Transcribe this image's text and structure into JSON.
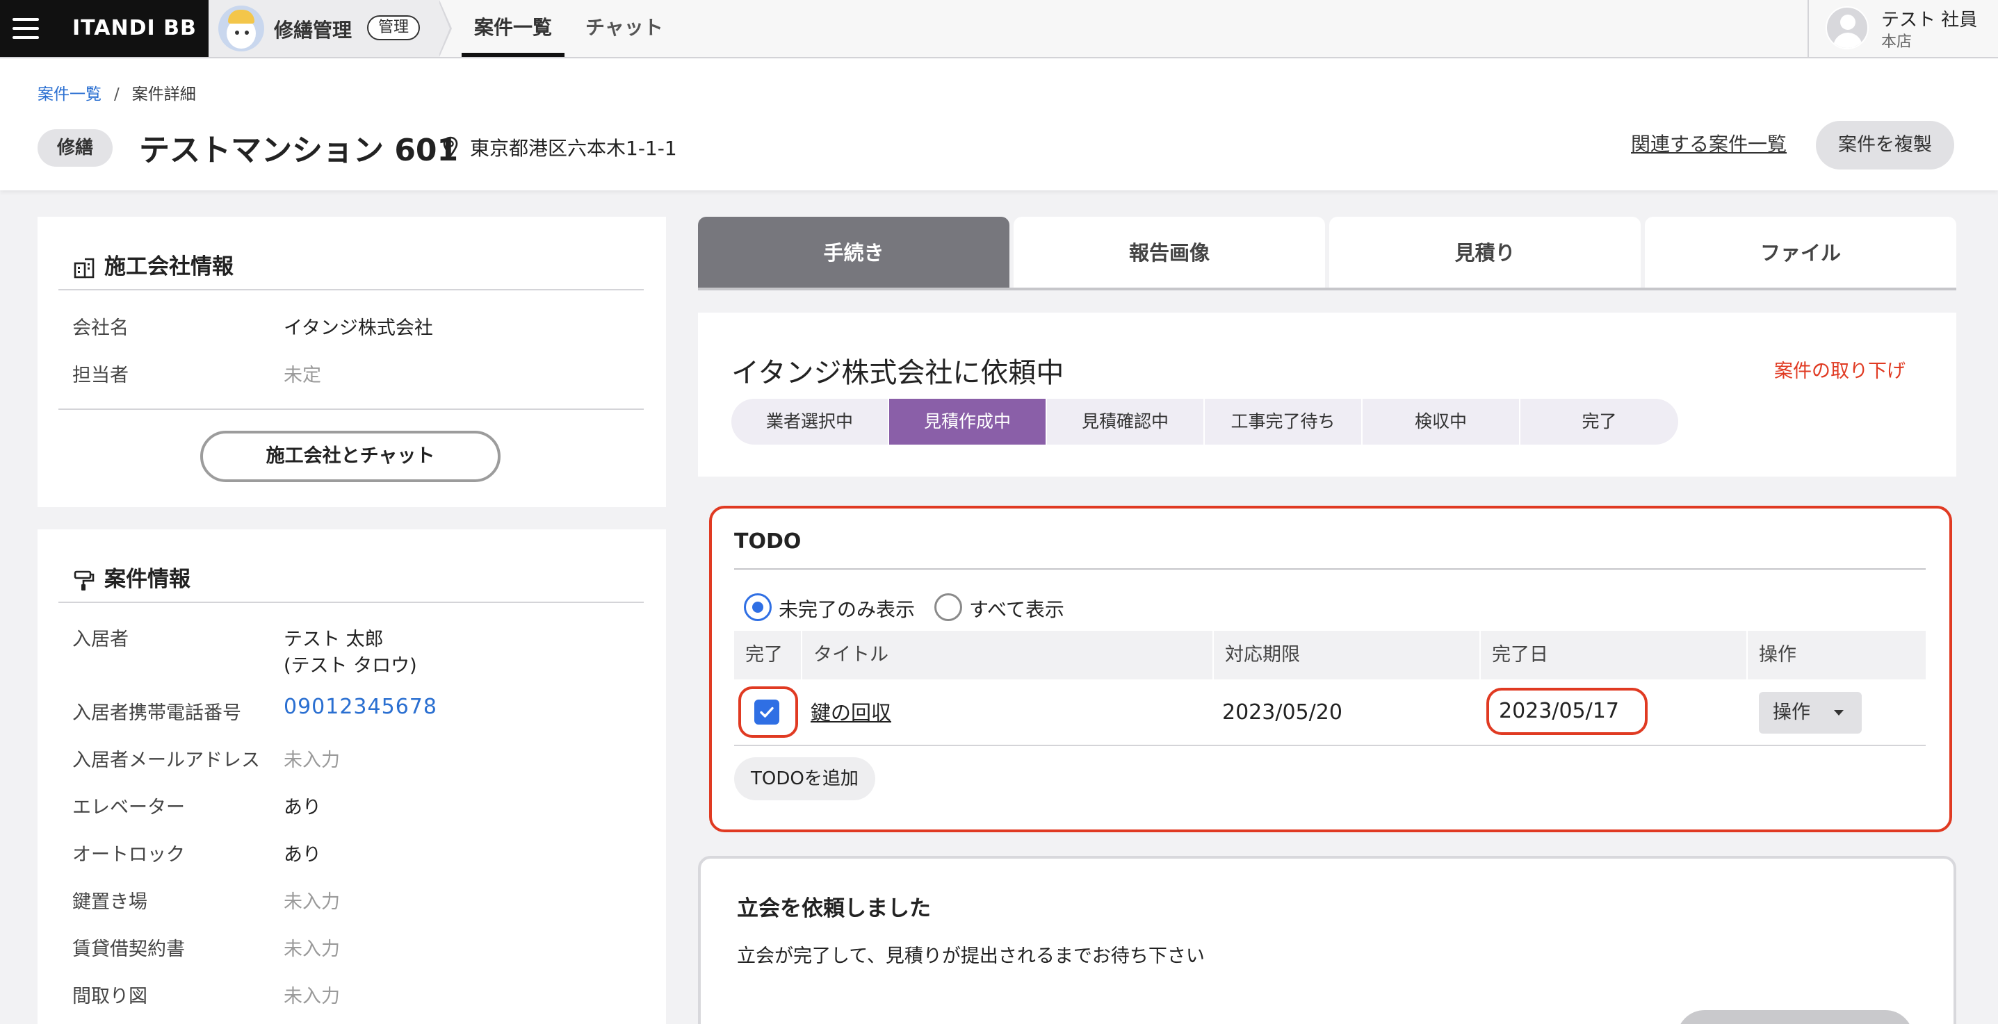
{
  "topbar": {
    "logo": "ITANDI BB",
    "app_name": "修繕管理",
    "app_badge": "管理",
    "nav": [
      "案件一覧",
      "チャット"
    ],
    "user_name": "テスト 社員",
    "user_branch": "本店"
  },
  "header": {
    "breadcrumb": [
      "案件一覧",
      "案件詳細"
    ],
    "breadcrumb_sep": "/",
    "category": "修繕",
    "title": "テストマンション 601",
    "address": "東京都港区六本木1-1-1",
    "related_link": "関連する案件一覧",
    "duplicate_button": "案件を複製"
  },
  "contractor": {
    "title": "施工会社情報",
    "rows": [
      {
        "label": "会社名",
        "value": "イタンジ株式会社"
      },
      {
        "label": "担当者",
        "value": "未定"
      }
    ],
    "chat_button": "施工会社とチャット"
  },
  "case_info": {
    "title": "案件情報",
    "tenant_label": "入居者",
    "tenant_name": "テスト 太郎",
    "tenant_kana": "(テスト タロウ)",
    "rows": [
      {
        "label": "入居者携帯電話番号",
        "value": "09012345678"
      },
      {
        "label": "入居者メールアドレス",
        "value": "未入力"
      },
      {
        "label": "エレベーター",
        "value": "あり"
      },
      {
        "label": "オートロック",
        "value": "あり"
      },
      {
        "label": "鍵置き場",
        "value": "未入力"
      },
      {
        "label": "賃貸借契約書",
        "value": "未入力"
      },
      {
        "label": "間取り図",
        "value": "未入力"
      }
    ]
  },
  "tabs": [
    "手続き",
    "報告画像",
    "見積り",
    "ファイル"
  ],
  "status": {
    "title": "イタンジ株式会社に依頼中",
    "withdraw": "案件の取り下げ",
    "steps": [
      "業者選択中",
      "見積作成中",
      "見積確認中",
      "工事完了待ち",
      "検収中",
      "完了"
    ],
    "active_step": "見積作成中"
  },
  "todo": {
    "title": "TODO",
    "filter_options": [
      "未完了のみ表示",
      "すべて表示"
    ],
    "selected_filter": "未完了のみ表示",
    "columns": [
      "完了",
      "タイトル",
      "対応期限",
      "完了日",
      "操作"
    ],
    "rows": [
      {
        "done": true,
        "title": "鍵の回収",
        "deadline": "2023/05/20",
        "completed": "2023/05/17",
        "action": "操作"
      }
    ],
    "add_button": "TODOを追加"
  },
  "meeting": {
    "title": "立会を依頼しました",
    "description": "立会が完了して、見積りが提出されるまでお待ち下さい"
  },
  "colors": {
    "accent": "#8a5fa8",
    "highlight": "#e03a22",
    "link": "#2a6fd1",
    "checkbox": "#2f6fe4"
  },
  "icons": [
    "menu-icon",
    "app-mascot-icon",
    "user-avatar-icon",
    "location-pin-icon",
    "building-icon",
    "paint-roller-icon",
    "check-icon",
    "caret-down-icon"
  ]
}
